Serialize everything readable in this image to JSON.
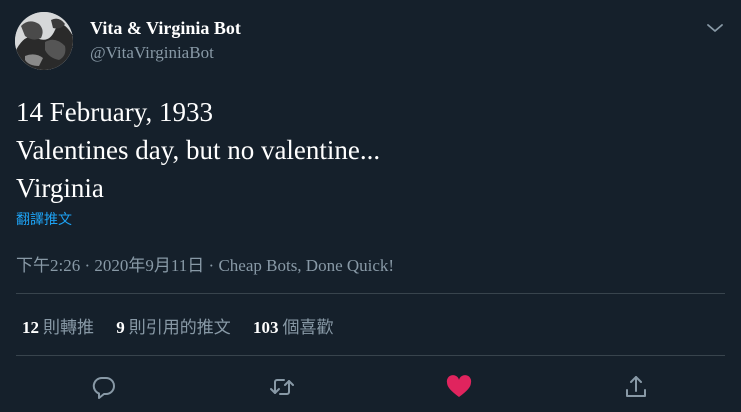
{
  "author": {
    "name": "Vita & Virginia Bot",
    "handle": "@VitaVirginiaBot"
  },
  "tweet": {
    "lines": [
      "14 February, 1933",
      "Valentines day, but no valentine...",
      "Virginia"
    ],
    "translate_label": "翻譯推文",
    "time": "下午2:26",
    "date": "2020年9月11日",
    "separator": "·",
    "source": "Cheap Bots, Done Quick!"
  },
  "stats": {
    "retweets": {
      "count": "12",
      "label": "則轉推"
    },
    "quotes": {
      "count": "9",
      "label": "則引用的推文"
    },
    "likes": {
      "count": "103",
      "label": "個喜歡"
    }
  },
  "actions": [
    {
      "icon": "reply-icon"
    },
    {
      "icon": "retweet-icon"
    },
    {
      "icon": "like-icon",
      "active": true,
      "color": "#e0245e"
    },
    {
      "icon": "share-icon"
    }
  ],
  "colors": {
    "background": "#15202b",
    "muted": "#8899a6",
    "accent": "#1da1f2",
    "like": "#e0245e",
    "divider": "#38444d"
  }
}
